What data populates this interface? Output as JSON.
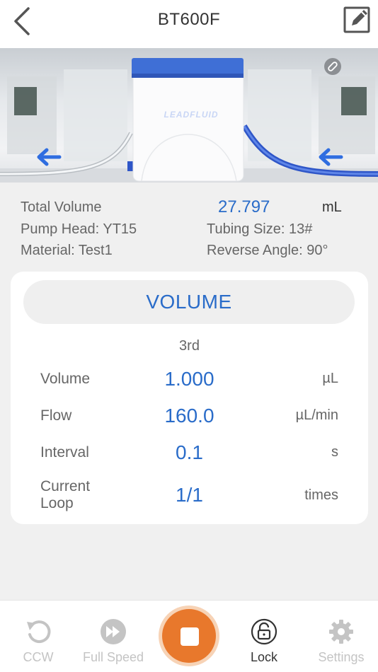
{
  "header": {
    "title": "BT600F"
  },
  "hero": {
    "brand": "LEADFLUID"
  },
  "info": {
    "total_volume_label": "Total Volume",
    "total_volume_value": "27.797",
    "total_volume_unit": "mL",
    "pump_head": "Pump Head: YT15",
    "tubing_size": "Tubing Size: 13#",
    "material": "Material: Test1",
    "reverse_angle": "Reverse Angle: 90°"
  },
  "card": {
    "mode": "VOLUME",
    "step": "3rd",
    "rows": [
      {
        "label": "Volume",
        "value": "1.000",
        "unit": "µL"
      },
      {
        "label": "Flow",
        "value": "160.0",
        "unit": "µL/min"
      },
      {
        "label": "Interval",
        "value": "0.1",
        "unit": "s"
      },
      {
        "label": "Current Loop",
        "label_line1": "Current",
        "label_line2": "Loop",
        "value": "1/1",
        "unit": "times"
      }
    ]
  },
  "tabbar": {
    "ccw": "CCW",
    "full_speed": "Full Speed",
    "lock": "Lock",
    "settings": "Settings"
  },
  "colors": {
    "accent_blue": "#2a6cc9",
    "stop_orange": "#e8782c",
    "inactive_gray": "#c4c4c4"
  },
  "icons": {
    "back": "chevron-left-icon",
    "edit": "edit-icon",
    "link": "link-icon",
    "ccw": "rotate-ccw-icon",
    "full_speed": "fast-forward-icon",
    "stop": "stop-icon",
    "lock": "lock-icon",
    "settings": "gear-icon"
  }
}
